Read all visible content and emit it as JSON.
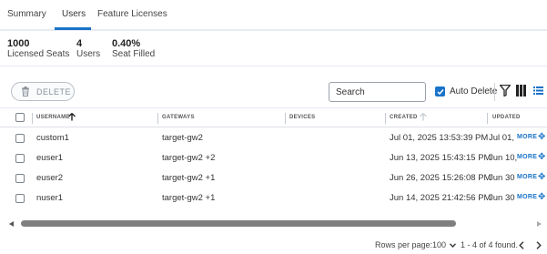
{
  "tabs": [
    {
      "label": "Summary"
    },
    {
      "label": "Users"
    },
    {
      "label": "Feature Licenses"
    }
  ],
  "active_tab": "Users",
  "stats": [
    {
      "value": "1000",
      "label": "Licensed Seats"
    },
    {
      "value": "4",
      "label": "Users"
    },
    {
      "value": "0.40%",
      "label": "Seat Filled"
    }
  ],
  "toolbar": {
    "delete_label": "DELETE",
    "search_placeholder": "Search",
    "auto_delete_label": "Auto Delete",
    "auto_delete_checked": true
  },
  "table": {
    "headers": {
      "username": "USERNAME",
      "gateways": "GATEWAYS",
      "devices": "DEVICES",
      "created": "CREATED",
      "updated": "UPDATED"
    },
    "rows": [
      {
        "username": "custom1",
        "gateways": "target-gw2",
        "devices": "",
        "created": "Jul 01, 2025 13:53:39 PM",
        "updated": "Jul 01,",
        "more": "MORE"
      },
      {
        "username": "euser1",
        "gateways": "target-gw2 +2",
        "devices": "",
        "created": "Jun 13, 2025 15:43:15 PM",
        "updated": "Jun 10,",
        "more": "MORE"
      },
      {
        "username": "euser2",
        "gateways": "target-gw2 +1",
        "devices": "",
        "created": "Jun 26, 2025 15:26:08 PM",
        "updated": "Jun 30",
        "more": "MORE"
      },
      {
        "username": "nuser1",
        "gateways": "target-gw2 +1",
        "devices": "",
        "created": "Jun 14, 2025 21:42:56 PM",
        "updated": "Jun 30",
        "more": "MORE"
      }
    ]
  },
  "pagination": {
    "rows_per_page_label": "Rows per page:",
    "rows_per_page_value": "100",
    "range_text": "1 - 4 of 4 found."
  },
  "colors": {
    "accent": "#1a73c8",
    "text": "#333333",
    "border": "#dde1e7"
  },
  "icons": [
    "trash-icon",
    "check-icon",
    "filter-icon",
    "columns-icon",
    "density-icon",
    "sort-up-icon",
    "move-icon",
    "chevron-left-icon",
    "chevron-right-icon",
    "caret-down-icon"
  ]
}
